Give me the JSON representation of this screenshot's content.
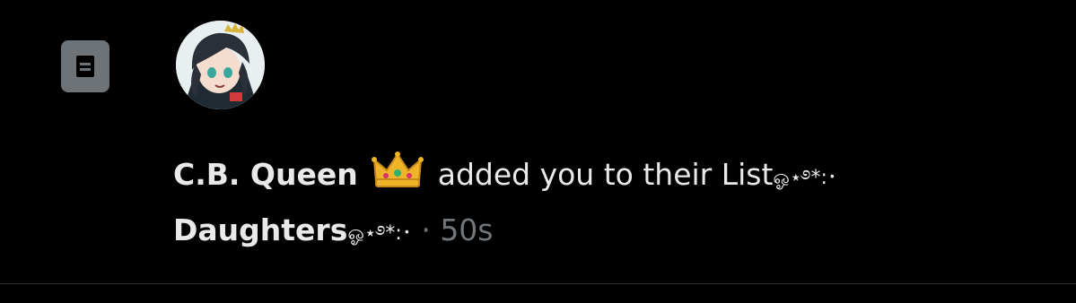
{
  "notification": {
    "icon": "list-icon",
    "avatar": "user-avatar",
    "user_name": "C.B. Queen",
    "user_emoji": "crown-emoji",
    "action_text": "added you to their List",
    "list_name_deco": "ஓ⋆࿔*:･",
    "list_name": "Daughters",
    "list_name_suffix": "ஓ⋆࿔*:･",
    "separator": " · ",
    "timestamp": "50s"
  },
  "colors": {
    "background": "#000000",
    "primary_text": "#e7e9ea",
    "secondary_text": "#71767b",
    "icon_bg": "#6e7378",
    "divider": "#2f3336"
  }
}
